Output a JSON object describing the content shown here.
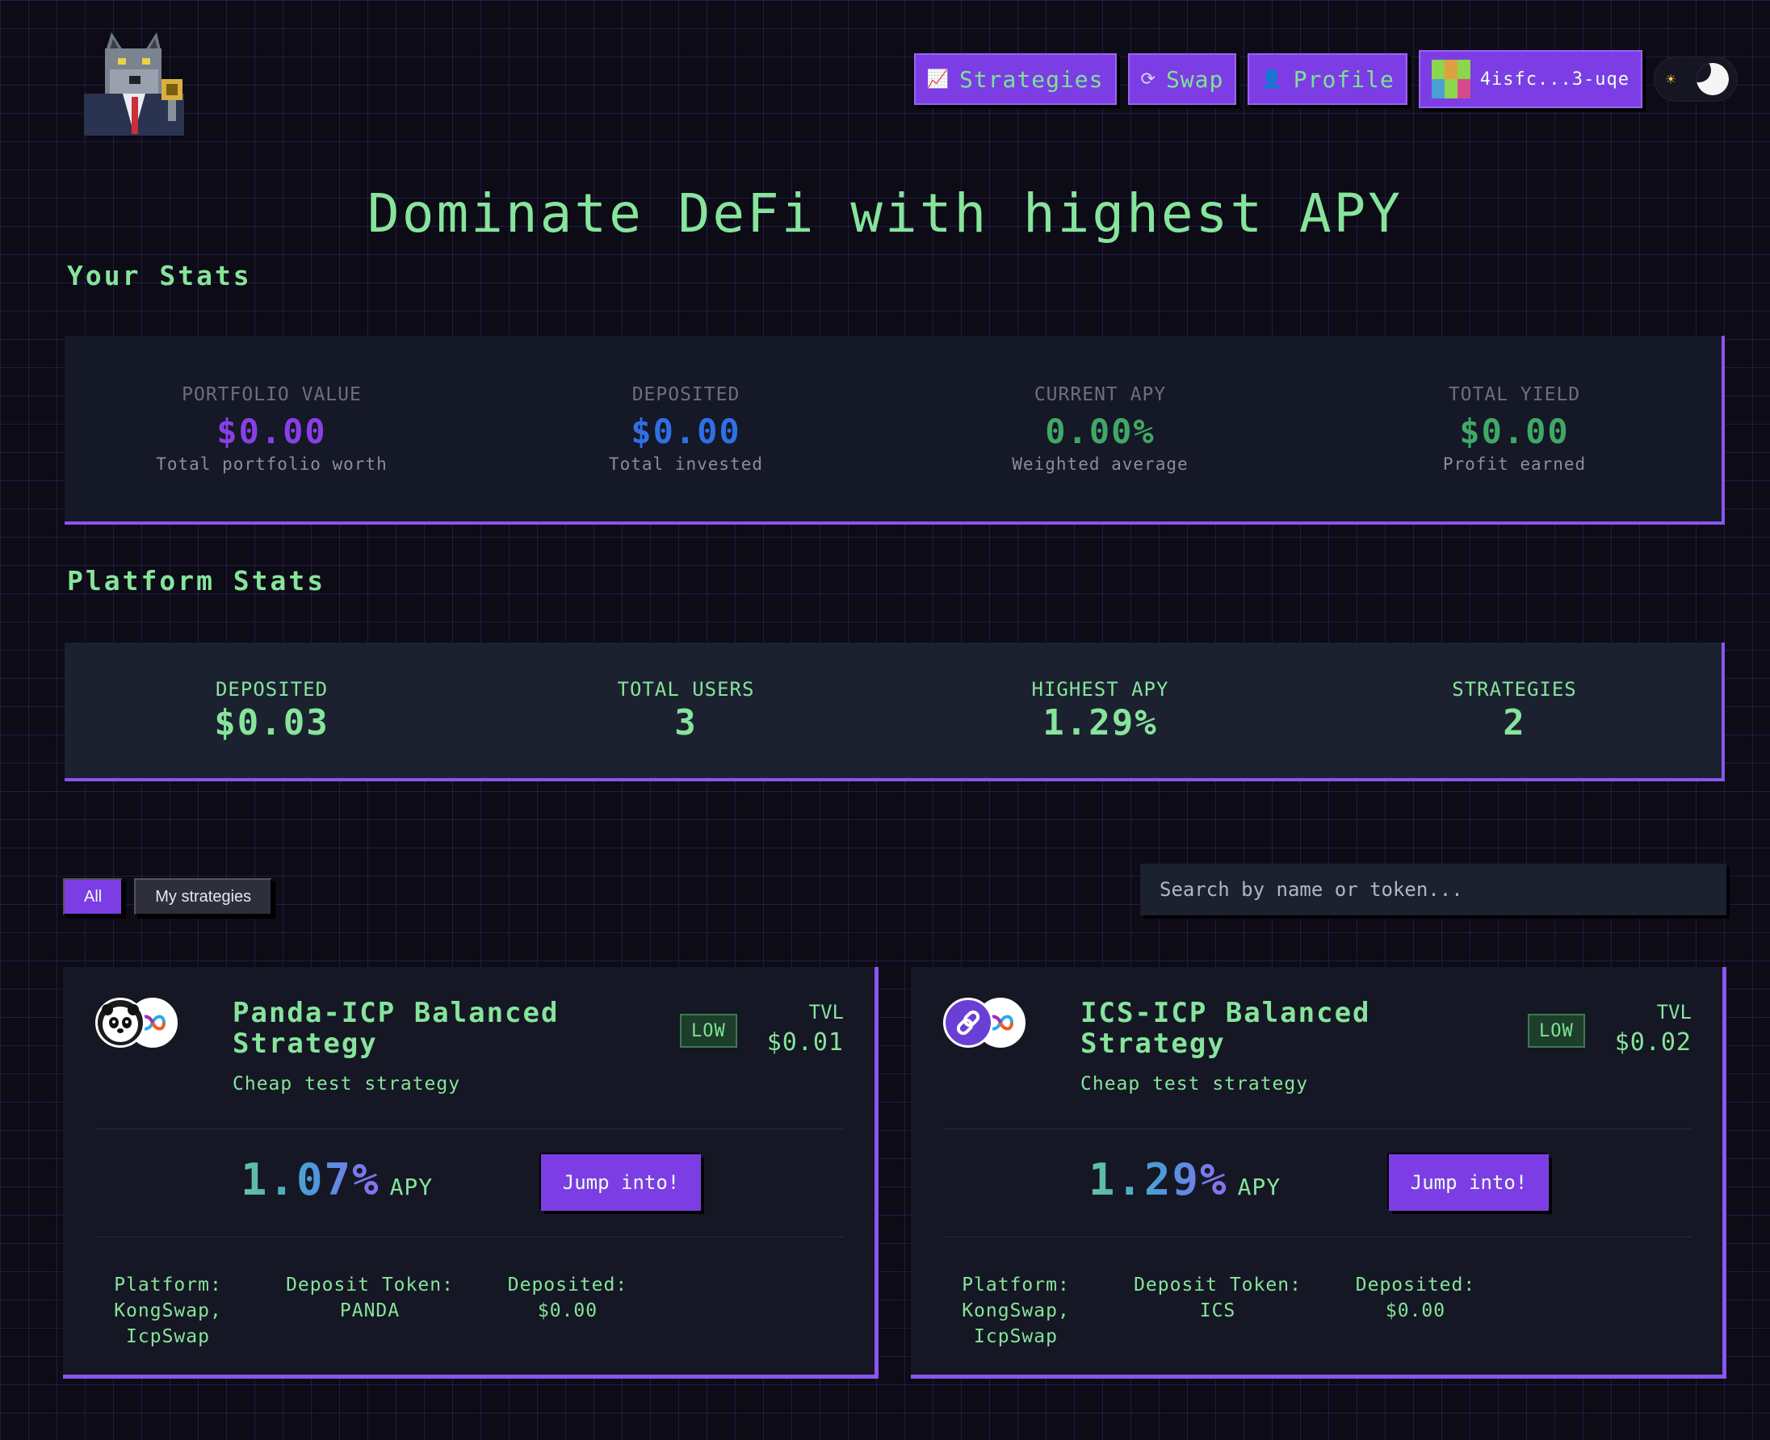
{
  "header": {
    "logo_alt": "wolf mascot logo",
    "nav": [
      {
        "label": "Strategies",
        "icon": "chart-icon"
      },
      {
        "label": "Swap",
        "icon": "swap-icon"
      },
      {
        "label": "Profile",
        "icon": "profile-icon"
      }
    ],
    "wallet": {
      "label": "4isfc...3-uqe",
      "icon": "wallet-avatar-icon"
    },
    "theme_toggle": {
      "mode": "dark"
    }
  },
  "hero": {
    "title": "Dominate DeFi with highest APY"
  },
  "your_stats": {
    "title": "Your Stats",
    "items": [
      {
        "label": "PORTFOLIO VALUE",
        "value": "$0.00",
        "sub": "Total portfolio worth",
        "color": "#8a3fe6"
      },
      {
        "label": "DEPOSITED",
        "value": "$0.00",
        "sub": "Total invested",
        "color": "#2f6fe6"
      },
      {
        "label": "CURRENT APY",
        "value": "0.00%",
        "sub": "Weighted average",
        "color": "#3fa866"
      },
      {
        "label": "TOTAL YIELD",
        "value": "$0.00",
        "sub": "Profit earned",
        "color": "#3fa866"
      }
    ]
  },
  "platform_stats": {
    "title": "Platform Stats",
    "items": [
      {
        "label": "DEPOSITED",
        "value": "$0.03"
      },
      {
        "label": "TOTAL USERS",
        "value": "3"
      },
      {
        "label": "HIGHEST APY",
        "value": "1.29%"
      },
      {
        "label": "STRATEGIES",
        "value": "2"
      }
    ]
  },
  "filters": {
    "tabs": [
      {
        "label": "All",
        "active": true
      },
      {
        "label": "My strategies",
        "active": false
      }
    ],
    "search_placeholder": "Search by name or token..."
  },
  "strategies": [
    {
      "title": "Panda-ICP Balanced Strategy",
      "description": "Cheap test strategy",
      "risk": "LOW",
      "tvl_label": "TVL",
      "tvl": "$0.01",
      "apy": "1.07%",
      "apy_unit": "APY",
      "action": "Jump into!",
      "platform_label": "Platform:",
      "platform": "KongSwap, IcpSwap",
      "deposit_token_label": "Deposit Token:",
      "deposit_token": "PANDA",
      "deposited_label": "Deposited:",
      "deposited": "$0.00",
      "tokens": [
        "panda-token-icon",
        "icp-token-icon"
      ]
    },
    {
      "title": "ICS-ICP Balanced Strategy",
      "description": "Cheap test strategy",
      "risk": "LOW",
      "tvl_label": "TVL",
      "tvl": "$0.02",
      "apy": "1.29%",
      "apy_unit": "APY",
      "action": "Jump into!",
      "platform_label": "Platform:",
      "platform": "KongSwap, IcpSwap",
      "deposit_token_label": "Deposit Token:",
      "deposit_token": "ICS",
      "deposited_label": "Deposited:",
      "deposited": "$0.00",
      "tokens": [
        "ics-token-icon",
        "icp-token-icon"
      ]
    }
  ]
}
